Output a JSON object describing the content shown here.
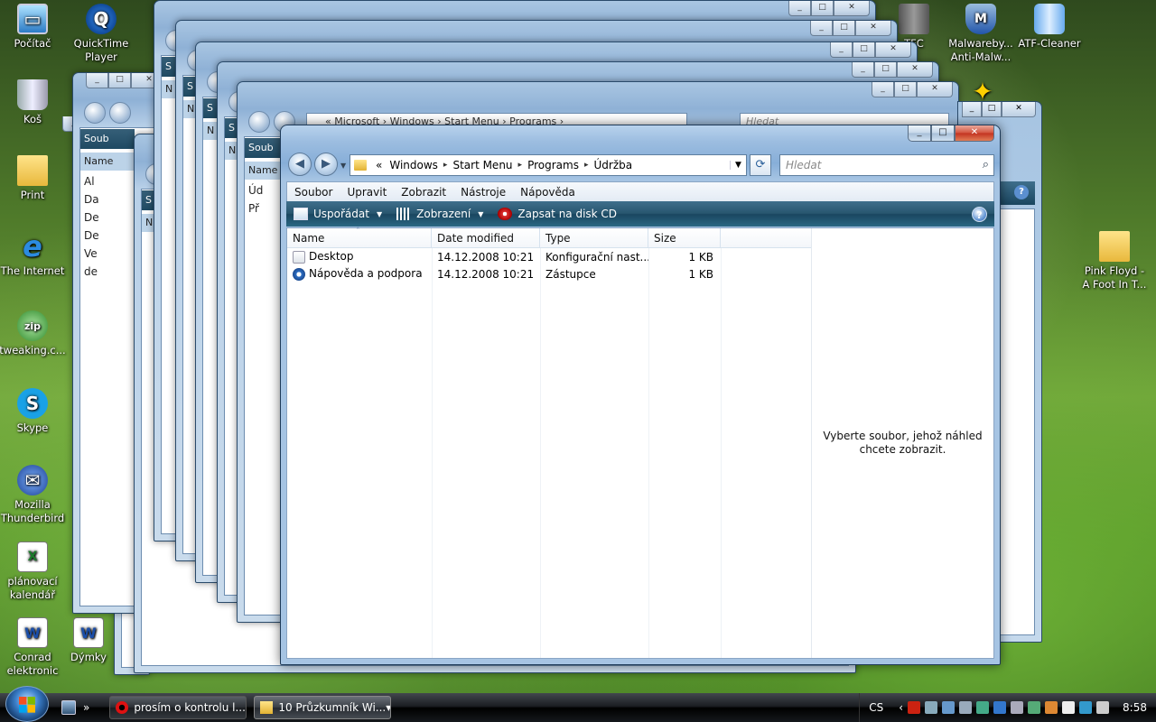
{
  "desktop": {
    "left_icons": [
      {
        "label": "Počítač",
        "glyph": "▭",
        "icon": "computer-icon",
        "cls": "ic-pc"
      },
      {
        "label": "Koš",
        "glyph": "",
        "icon": "recycle-bin-icon",
        "cls": "ic-bin"
      },
      {
        "label": "Print",
        "glyph": "",
        "icon": "folder-icon",
        "cls": "ic-fold"
      },
      {
        "label": "The Internet",
        "glyph": "e",
        "icon": "internet-explorer-icon",
        "cls": "ic-ie"
      },
      {
        "label": "tweaking.c...",
        "glyph": "zip",
        "icon": "zip-icon",
        "cls": "ic-zip"
      },
      {
        "label": "Skype",
        "glyph": "S",
        "icon": "skype-icon",
        "cls": "ic-sky"
      },
      {
        "label": "Mozilla Thunderbird",
        "glyph": "✉",
        "icon": "thunderbird-icon",
        "cls": "ic-tb"
      },
      {
        "label": "plánovací kalendář",
        "glyph": "X",
        "icon": "excel-file-icon",
        "cls": "ic-xls"
      },
      {
        "label": "Conrad elektronic",
        "glyph": "W",
        "icon": "word-file-icon",
        "cls": "ic-doc"
      }
    ],
    "second_column": [
      {
        "label": "QuickTime Player",
        "glyph": "Q",
        "icon": "quicktime-icon",
        "cls": "ic-qt"
      },
      {
        "label": "Dýmky",
        "glyph": "W",
        "icon": "word-file-icon",
        "cls": "ic-doc"
      }
    ],
    "right_icons": [
      {
        "label": "TFC",
        "glyph": "",
        "icon": "tfc-icon",
        "cls": "ic-trash"
      },
      {
        "label": "Malwareby... Anti-Malw...",
        "glyph": "M",
        "icon": "malwarebytes-icon",
        "cls": "ic-shield"
      },
      {
        "label": "ATF-Cleaner",
        "glyph": "",
        "icon": "atf-cleaner-icon",
        "cls": "ic-can"
      },
      {
        "label": "Pink Floyd - A Foot In T...",
        "glyph": "",
        "icon": "folder-icon",
        "cls": "ic-fold"
      }
    ]
  },
  "background_windows": [
    {
      "crumb": "",
      "left_rows": [
        "S",
        "N"
      ]
    },
    {
      "crumb": "",
      "left_rows": [
        "S",
        "N"
      ]
    },
    {
      "crumb": "",
      "left_rows": [
        "S",
        "N"
      ]
    },
    {
      "crumb": "",
      "left_rows": [
        "S",
        "N"
      ]
    },
    {
      "crumb": "« Microsoft › Windows › Start Menu › Programs ›",
      "left_rows": [
        "Soub",
        "Name",
        "Úd",
        "Př"
      ]
    },
    {
      "crumb": "",
      "left_rows": [
        "Soub",
        "Name",
        "Al",
        "Da",
        "De",
        "De",
        "Ve",
        "de"
      ]
    }
  ],
  "background_search_placeholder": "Hledat",
  "window": {
    "caption_buttons": {
      "minimize": "_",
      "maximize": "□",
      "close": "✕"
    },
    "nav": {
      "back": "◀",
      "forward": "▶",
      "history": "▼"
    },
    "breadcrumb": {
      "overflow": "«",
      "segments": [
        "Windows",
        "Start Menu",
        "Programs",
        "Údržba"
      ],
      "separator": "▸",
      "dropdown": "▼"
    },
    "refresh_glyph": "⟳",
    "search": {
      "placeholder": "Hledat",
      "icon": "⌕"
    },
    "menu": [
      "Soubor",
      "Upravit",
      "Zobrazit",
      "Nástroje",
      "Nápověda"
    ],
    "commands": {
      "organize": "Uspořádat",
      "views": "Zobrazení",
      "burn": "Zapsat na disk CD",
      "arrow": "▼",
      "help": "?"
    },
    "columns": [
      "Name",
      "Date modified",
      "Type",
      "Size"
    ],
    "sort_glyph": "ˆ",
    "files": [
      {
        "name": "Desktop",
        "date": "14.12.2008 10:21",
        "type": "Konfigurační nast...",
        "size": "1 KB",
        "icon": "ini-file-icon"
      },
      {
        "name": "Nápověda a podpora",
        "date": "14.12.2008 10:21",
        "type": "Zástupce",
        "size": "1 KB",
        "icon": "help-shortcut-icon"
      }
    ],
    "preview_text": "Vyberte soubor, jehož náhled chcete zobrazit."
  },
  "taskbar": {
    "quick_launch_more": "»",
    "buttons": [
      {
        "label": "prosím o kontrolu l...",
        "icon": "opera-icon",
        "active": false
      },
      {
        "label": "10 Průzkumník Wi...",
        "icon": "folder-icon",
        "active": true,
        "dropdown": "▼"
      }
    ],
    "language": "CS",
    "tray_expand": "‹",
    "clock": "8:58"
  }
}
